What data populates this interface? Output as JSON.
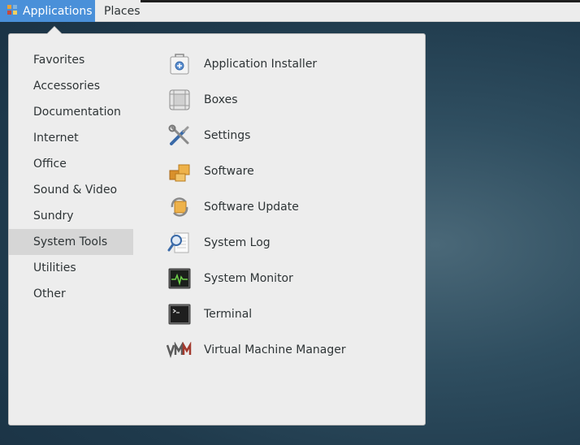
{
  "topbar": {
    "applications_label": "Applications",
    "places_label": "Places"
  },
  "categories": [
    {
      "label": "Favorites"
    },
    {
      "label": "Accessories"
    },
    {
      "label": "Documentation"
    },
    {
      "label": "Internet"
    },
    {
      "label": "Office"
    },
    {
      "label": "Sound & Video"
    },
    {
      "label": "Sundry"
    },
    {
      "label": "System Tools",
      "selected": true
    },
    {
      "label": "Utilities"
    },
    {
      "label": "Other"
    }
  ],
  "apps": [
    {
      "label": "Application Installer",
      "icon": "package-installer-icon"
    },
    {
      "label": "Boxes",
      "icon": "boxes-icon"
    },
    {
      "label": "Settings",
      "icon": "settings-tools-icon"
    },
    {
      "label": "Software",
      "icon": "software-icon"
    },
    {
      "label": "Software Update",
      "icon": "software-update-icon"
    },
    {
      "label": "System Log",
      "icon": "system-log-icon"
    },
    {
      "label": "System Monitor",
      "icon": "system-monitor-icon"
    },
    {
      "label": "Terminal",
      "icon": "terminal-icon"
    },
    {
      "label": "Virtual Machine Manager",
      "icon": "virtual-machine-manager-icon"
    }
  ]
}
